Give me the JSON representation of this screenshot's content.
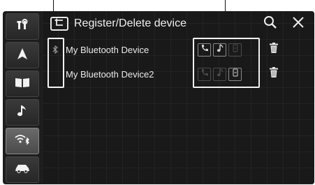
{
  "header": {
    "title": "Register/Delete device"
  },
  "sidebar": {
    "items": [
      {
        "icon": "settings-tools-icon",
        "active": false
      },
      {
        "icon": "navigation-arrow-icon",
        "active": false
      },
      {
        "icon": "book-icon",
        "active": false
      },
      {
        "icon": "music-note-icon",
        "active": false
      },
      {
        "icon": "wifi-bluetooth-icon",
        "active": true
      },
      {
        "icon": "car-icon",
        "active": false
      }
    ]
  },
  "devices": [
    {
      "name": "My Bluetooth Device",
      "connected": true,
      "profiles": {
        "phone": true,
        "audio": true,
        "app": false
      }
    },
    {
      "name": "My Bluetooth Device2",
      "connected": false,
      "profiles": {
        "phone": false,
        "audio": false,
        "app": true
      }
    }
  ],
  "colors": {
    "background": "#1d1d1d",
    "text": "#f0f0f0",
    "active_tab": "#5a5a5a",
    "highlight_box": "#f2f2f2"
  }
}
